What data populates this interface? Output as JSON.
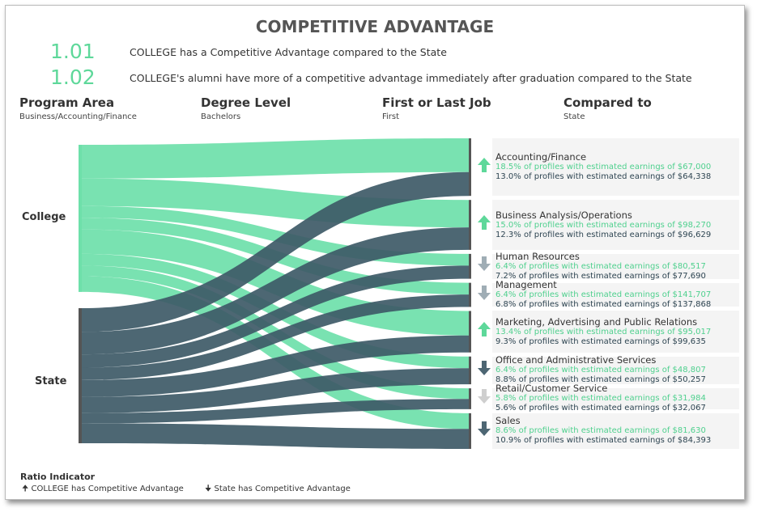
{
  "title": "COMPETITIVE ADVANTAGE",
  "ratios": [
    {
      "value": "1.01",
      "text": "COLLEGE has a Competitive Advantage compared to the State"
    },
    {
      "value": "1.02",
      "text": "COLLEGE's alumni have more of a competitive advantage immediately after graduation compared to the State"
    }
  ],
  "filters": [
    {
      "label": "Program Area",
      "value": "Business/Accounting/Finance"
    },
    {
      "label": "Degree Level",
      "value": "Bachelors"
    },
    {
      "label": "First or Last Job",
      "value": "First"
    },
    {
      "label": "Compared to",
      "value": "State"
    }
  ],
  "colors": {
    "college": "#6ee0aa",
    "state": "#3e5a67",
    "up": "#5ed89a",
    "down_strong": "#4d6673",
    "down_medium": "#9fadb5",
    "down_weak": "#cfcfcf"
  },
  "chart_data": {
    "type": "sankey",
    "sources": [
      "College",
      "State"
    ],
    "unit": "% of profiles",
    "targets": [
      {
        "name": "Accounting/Finance",
        "arrow": "up",
        "college_pct": 18.5,
        "college_earn": "$67,000",
        "state_pct": 13.0,
        "state_earn": "$64,338",
        "college_line": "18.5% of profiles with estimated earnings of $67,000",
        "state_line": "13.0% of profiles with estimated earnings of $64,338"
      },
      {
        "name": "Business Analysis/Operations",
        "arrow": "up",
        "college_pct": 15.0,
        "college_earn": "$98,270",
        "state_pct": 12.3,
        "state_earn": "$96,629",
        "college_line": "15.0% of profiles with estimated earnings of $98,270",
        "state_line": "12.3% of profiles with estimated earnings of $96,629"
      },
      {
        "name": "Human Resources",
        "arrow": "down_medium",
        "college_pct": 6.4,
        "college_earn": "$80,517",
        "state_pct": 7.2,
        "state_earn": "$77,690",
        "college_line": "6.4% of profiles with estimated earnings of $80,517",
        "state_line": "7.2% of profiles with estimated earnings of $77,690"
      },
      {
        "name": "Management",
        "arrow": "down_medium",
        "college_pct": 6.4,
        "college_earn": "$141,707",
        "state_pct": 6.8,
        "state_earn": "$137,868",
        "college_line": "6.4% of profiles with estimated earnings of $141,707",
        "state_line": "6.8% of profiles with estimated earnings of $137,868"
      },
      {
        "name": "Marketing, Advertising and Public Relations",
        "arrow": "up",
        "college_pct": 13.4,
        "college_earn": "$95,017",
        "state_pct": 9.3,
        "state_earn": "$99,635",
        "college_line": "13.4% of profiles with estimated earnings of $95,017",
        "state_line": "9.3% of profiles with estimated earnings of $99,635"
      },
      {
        "name": "Office and Administrative Services",
        "arrow": "down_strong",
        "college_pct": 6.4,
        "college_earn": "$48,807",
        "state_pct": 8.8,
        "state_earn": "$50,257",
        "college_line": "6.4% of profiles with estimated earnings of $48,807",
        "state_line": "8.8% of profiles with estimated earnings of $50,257"
      },
      {
        "name": "Retail/Customer Service",
        "arrow": "down_weak",
        "college_pct": 5.8,
        "college_earn": "$31,984",
        "state_pct": 5.6,
        "state_earn": "$32,067",
        "college_line": "5.8% of profiles with estimated earnings of $31,984",
        "state_line": "5.6% of profiles with estimated earnings of $32,067"
      },
      {
        "name": "Sales",
        "arrow": "down_strong",
        "college_pct": 8.6,
        "college_earn": "$81,630",
        "state_pct": 10.9,
        "state_earn": "$84,393",
        "college_line": "8.6% of profiles with estimated earnings of $81,630",
        "state_line": "10.9% of profiles with estimated earnings of $84,393"
      }
    ]
  },
  "legend": {
    "title": "Ratio Indicator",
    "up": "COLLEGE has Competitive Advantage",
    "down": "State has Competitive Advantage"
  }
}
